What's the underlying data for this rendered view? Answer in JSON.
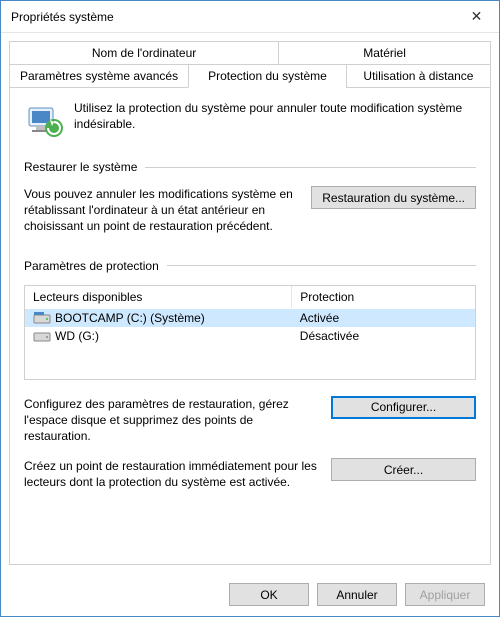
{
  "window": {
    "title": "Propriétés système"
  },
  "tabs": {
    "row1": [
      "Nom de l'ordinateur",
      "Matériel"
    ],
    "row2": [
      "Paramètres système avancés",
      "Protection du système",
      "Utilisation à distance"
    ]
  },
  "intro": "Utilisez la protection du système pour annuler toute modification système indésirable.",
  "restore": {
    "title": "Restaurer le système",
    "text": "Vous pouvez annuler les modifications système en rétablissant l'ordinateur à un état antérieur en choisissant un point de restauration précédent.",
    "button": "Restauration du système..."
  },
  "protection": {
    "title": "Paramètres de protection",
    "col_drive": "Lecteurs disponibles",
    "col_protection": "Protection",
    "drives": [
      {
        "name": "BOOTCAMP (C:) (Système)",
        "protection": "Activée",
        "selected": true
      },
      {
        "name": "WD (G:)",
        "protection": "Désactivée",
        "selected": false
      }
    ],
    "configure_text": "Configurez des paramètres de restauration, gérez l'espace disque et supprimez des points de restauration.",
    "configure_button": "Configurer...",
    "create_text": "Créez un point de restauration immédiatement pour les lecteurs dont la protection du système est activée.",
    "create_button": "Créer..."
  },
  "footer": {
    "ok": "OK",
    "cancel": "Annuler",
    "apply": "Appliquer"
  }
}
